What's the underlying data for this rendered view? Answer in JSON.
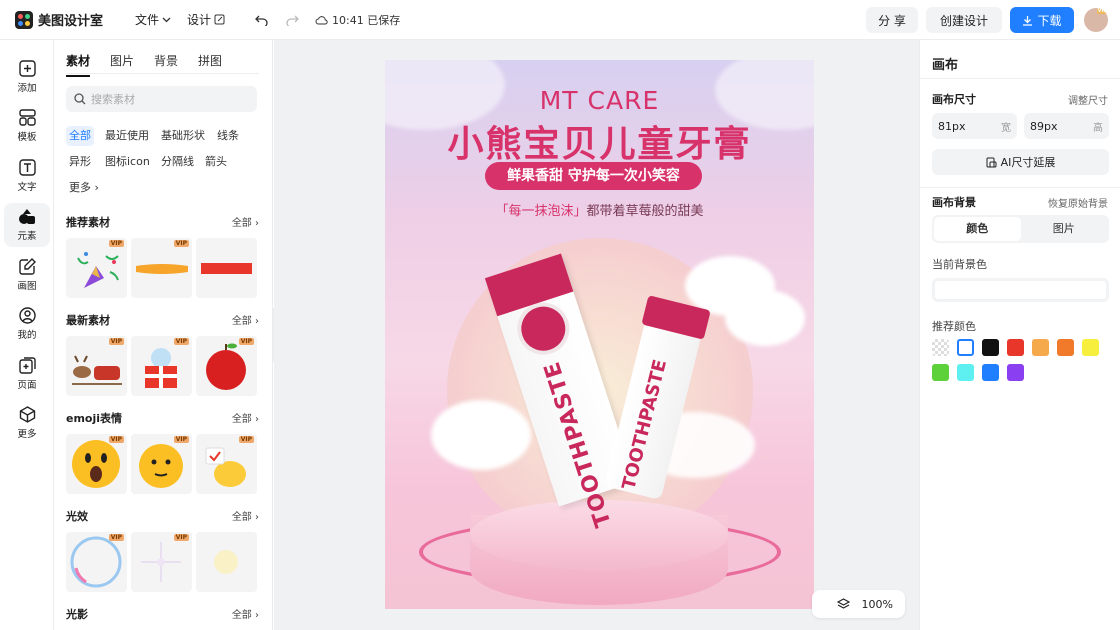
{
  "app": {
    "name": "美图设计室"
  },
  "topbar": {
    "file_label": "文件",
    "design_label": "设计",
    "saved_text": "10:41 已保存",
    "share_label": "分 享",
    "create_label": "创建设计",
    "download_label": "下载",
    "avatar_badge": "VIP",
    "accent": "#1f7fff"
  },
  "rail": {
    "items": [
      {
        "label": "添加",
        "icon": "plus-square-icon"
      },
      {
        "label": "模板",
        "icon": "template-icon"
      },
      {
        "label": "文字",
        "icon": "text-icon"
      },
      {
        "label": "元素",
        "icon": "shapes-icon",
        "active": true
      },
      {
        "label": "画图",
        "icon": "draw-icon"
      },
      {
        "label": "我的",
        "icon": "user-icon"
      },
      {
        "label": "页面",
        "icon": "page-add-icon"
      },
      {
        "label": "更多",
        "icon": "cube-icon"
      }
    ]
  },
  "panel": {
    "tabs": [
      "素材",
      "图片",
      "背景",
      "拼图"
    ],
    "search_placeholder": "搜索素材",
    "chips": [
      "全部",
      "最近使用",
      "基础形状",
      "线条",
      "异形",
      "图标icon",
      "分隔线",
      "箭头",
      "更多"
    ],
    "all_label": "全部",
    "vip_label": "VIP",
    "sections": [
      "推荐素材",
      "最新素材",
      "emoji表情",
      "光效",
      "光影"
    ]
  },
  "poster": {
    "brand": "MT CARE",
    "title": "小熊宝贝儿童牙膏",
    "pill": "鲜果香甜 守护每一次小笑容",
    "tagline_highlight": "「每一抹泡沫」",
    "tagline_rest": "都带着草莓般的甜美",
    "box_text": "TOOTHPASTE",
    "tube_text": "TOOTHPASTE"
  },
  "zoom": {
    "level": "100%"
  },
  "right": {
    "title": "画布",
    "size_label": "画布尺寸",
    "resize_label": "调整尺寸",
    "width_value": "81px",
    "width_suffix": "宽",
    "height_value": "89px",
    "height_suffix": "高",
    "ai_button": "AI尺寸延展",
    "bg_label": "画布背景",
    "restore_label": "恢复原始背景",
    "seg_color": "颜色",
    "seg_image": "图片",
    "current_bg_label": "当前背景色",
    "recommend_label": "推荐颜色",
    "swatches": [
      "transparent",
      "#ffffff",
      "#111111",
      "#e8362a",
      "#f6a94a",
      "#f07a2a",
      "#f7ef3d",
      "#5dd13a",
      "#5ef0f0",
      "#1f7fff",
      "#8a3ff0"
    ]
  }
}
